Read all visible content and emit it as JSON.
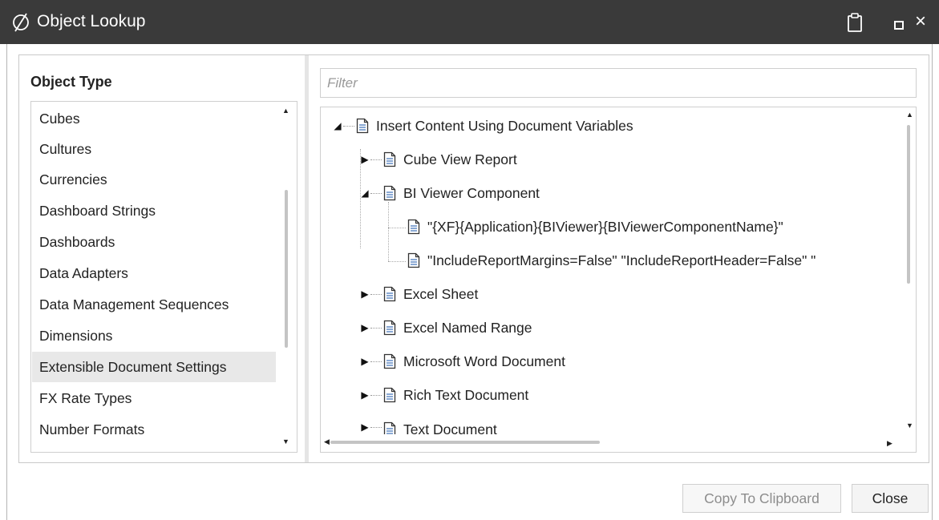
{
  "window": {
    "title": "Object Lookup",
    "logo_icon": "slashed-circle-logo",
    "controls": [
      "clipboard-icon",
      "maximize-icon",
      "close-icon"
    ],
    "close_glyph": "×"
  },
  "object_type": {
    "header": "Object Type",
    "items": [
      {
        "label": "Cubes"
      },
      {
        "label": "Cultures"
      },
      {
        "label": "Currencies"
      },
      {
        "label": "Dashboard Strings"
      },
      {
        "label": "Dashboards"
      },
      {
        "label": "Data Adapters"
      },
      {
        "label": "Data Management Sequences"
      },
      {
        "label": "Dimensions"
      },
      {
        "label": "Extensible Document Settings"
      },
      {
        "label": "FX Rate Types"
      },
      {
        "label": "Number Formats"
      }
    ],
    "selected": "Extensible Document Settings"
  },
  "filter": {
    "placeholder": "Filter",
    "value": ""
  },
  "tree": {
    "root": {
      "label": "Insert Content Using Document Variables",
      "expanded": true
    },
    "children": [
      {
        "label": "Cube View Report",
        "expanded": false
      },
      {
        "label": "BI Viewer Component",
        "expanded": true,
        "children": [
          {
            "label": "\"{XF}{Application}{BIViewer}{BIViewerComponentName}\""
          },
          {
            "label": "\"IncludeReportMargins=False\" \"IncludeReportHeader=False\" \""
          }
        ]
      },
      {
        "label": "Excel Sheet",
        "expanded": false
      },
      {
        "label": "Excel Named Range",
        "expanded": false
      },
      {
        "label": "Microsoft Word Document",
        "expanded": false
      },
      {
        "label": "Rich Text Document",
        "expanded": false
      },
      {
        "label": "Text Document",
        "expanded": false
      }
    ],
    "expanded_glyph": "◢",
    "collapsed_glyph": "▶"
  },
  "scroll_glyphs": {
    "up": "▲",
    "down": "▼",
    "left": "◀",
    "right": "▶"
  },
  "buttons": {
    "copy": "Copy To Clipboard",
    "close": "Close"
  },
  "colors": {
    "titlebar": "#3a3a3a",
    "selected_row": "#e8e8e8",
    "disabled_text": "#8d8d8d"
  }
}
